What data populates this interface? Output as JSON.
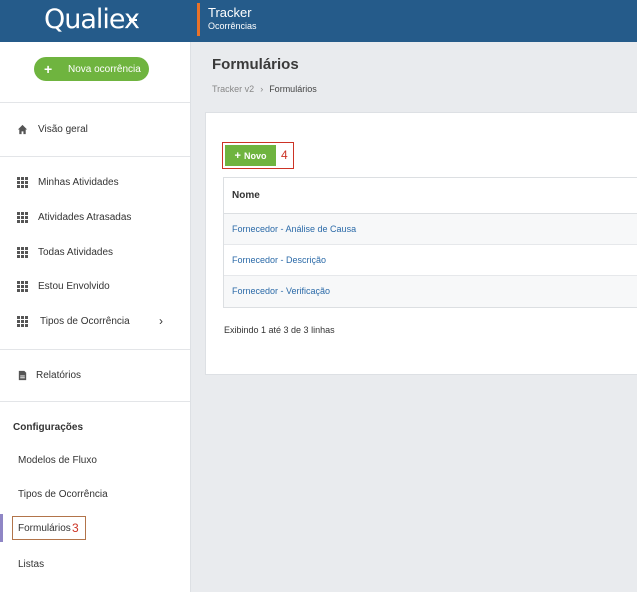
{
  "topbar": {
    "logo": "Qualiex",
    "module_title": "Tracker",
    "module_subtitle": "Ocorrências"
  },
  "sidebar": {
    "new_button": "Nova ocorrência",
    "items": [
      {
        "label": "Visão geral",
        "icon": "home-icon"
      },
      {
        "label": "Minhas Atividades",
        "icon": "grid-icon"
      },
      {
        "label": "Atividades Atrasadas",
        "icon": "grid-icon"
      },
      {
        "label": "Todas Atividades",
        "icon": "grid-icon"
      },
      {
        "label": "Estou Envolvido",
        "icon": "grid-icon"
      },
      {
        "label": "Tipos de Ocorrência",
        "icon": "grid-icon"
      },
      {
        "label": "Relatórios",
        "icon": "document-icon"
      }
    ],
    "config_title": "Configurações",
    "config_items": [
      "Modelos de Fluxo",
      "Tipos de Ocorrência",
      "Formulários",
      "Listas"
    ],
    "annotation": "3"
  },
  "main": {
    "title": "Formulários",
    "breadcrumb": [
      "Tracker v2",
      "Formulários"
    ],
    "new_button": "Novo",
    "annotation": "4",
    "table": {
      "header": "Nome",
      "rows": [
        "Fornecedor - Análise de Causa",
        "Fornecedor - Descrição",
        "Fornecedor - Verificação"
      ]
    },
    "footer": "Exibindo 1 até 3 de 3 linhas"
  },
  "colors": {
    "topbar": "#255b8a",
    "accent_green": "#6fb43f",
    "annotation_red": "#cc3325",
    "link": "#2b6aa8"
  }
}
